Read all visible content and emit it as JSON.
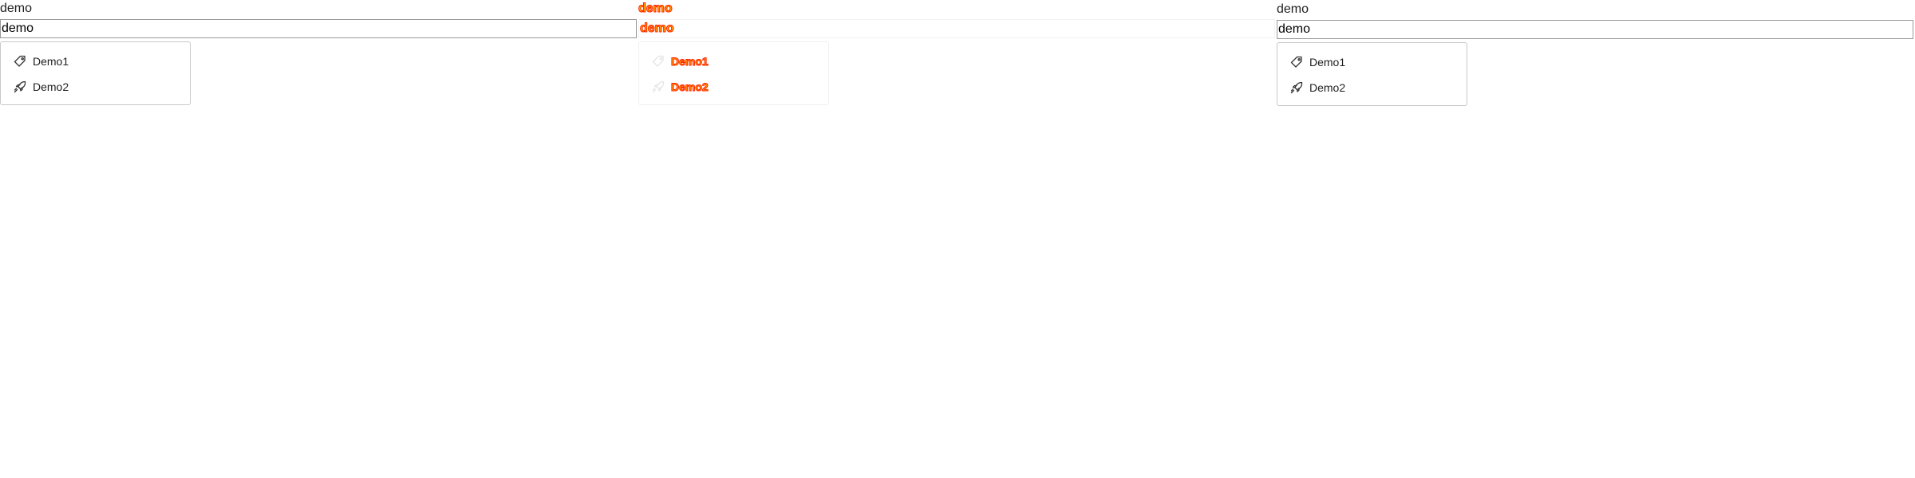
{
  "left": {
    "label": "demo",
    "input_value": "demo",
    "menu": [
      {
        "label": "Demo1",
        "icon": "tag-icon"
      },
      {
        "label": "Demo2",
        "icon": "rocket-icon"
      }
    ]
  },
  "middle": {
    "label": "demo",
    "input_value": "demo",
    "menu": [
      {
        "label": "Demo1",
        "icon": "tag-icon"
      },
      {
        "label": "Demo2",
        "icon": "rocket-icon"
      }
    ],
    "highlight_colors": {
      "outline": "#ff2200",
      "fill": "#ffb000",
      "background": "#ffff00"
    }
  },
  "right": {
    "label": "demo",
    "input_value": "demo",
    "menu": [
      {
        "label": "Demo1",
        "icon": "tag-icon"
      },
      {
        "label": "Demo2",
        "icon": "rocket-icon"
      }
    ]
  }
}
